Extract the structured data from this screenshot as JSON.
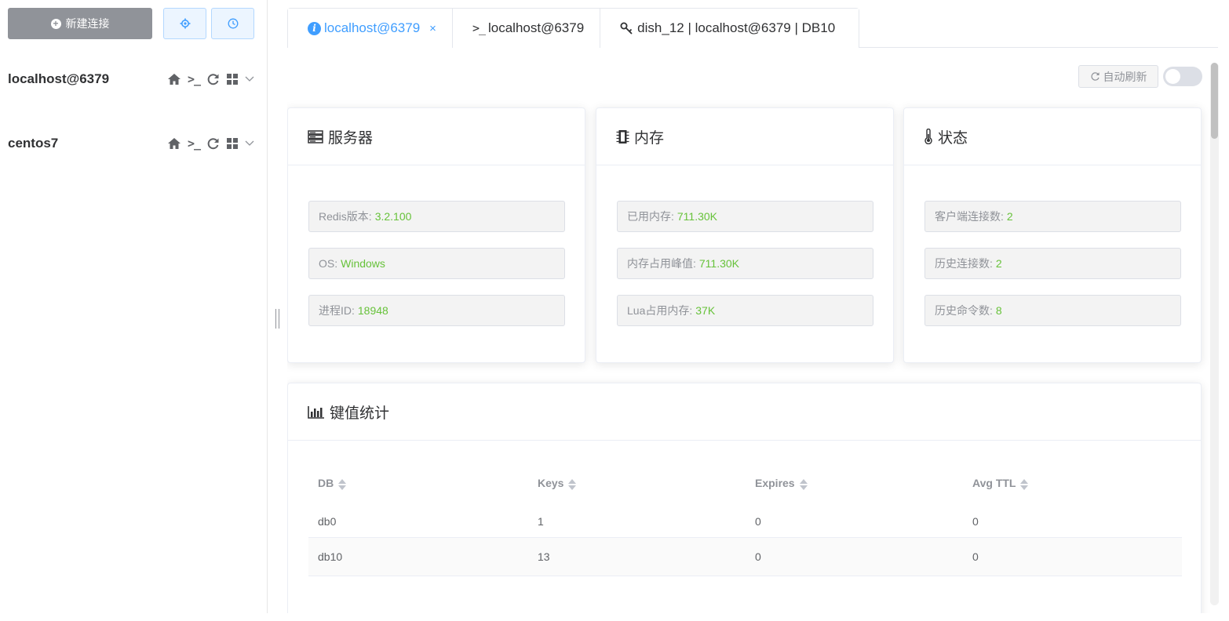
{
  "sidebar": {
    "new_connection_label": "新建连接",
    "connections": [
      {
        "name": "localhost@6379"
      },
      {
        "name": "centos7"
      }
    ],
    "terminal_glyph": ">_"
  },
  "tabs": [
    {
      "label": "localhost@6379",
      "icon": "info-icon",
      "active": true,
      "close": "×"
    },
    {
      "label": "localhost@6379",
      "icon": "terminal-icon",
      "glyph": ">_"
    },
    {
      "label": "dish_12 | localhost@6379 | DB10",
      "icon": "key-icon"
    }
  ],
  "toolbar": {
    "auto_refresh_label": "自动刷新",
    "auto_refresh_on": false
  },
  "server_card": {
    "title": "服务器",
    "rows": [
      {
        "label": "Redis版本:",
        "value": "3.2.100"
      },
      {
        "label": "OS:",
        "value": "Windows"
      },
      {
        "label": "进程ID:",
        "value": "18948"
      }
    ]
  },
  "memory_card": {
    "title": "内存",
    "rows": [
      {
        "label": "已用内存:",
        "value": "711.30K"
      },
      {
        "label": "内存占用峰值:",
        "value": "711.30K"
      },
      {
        "label": "Lua占用内存:",
        "value": "37K"
      }
    ]
  },
  "status_card": {
    "title": "状态",
    "rows": [
      {
        "label": "客户端连接数:",
        "value": "2"
      },
      {
        "label": "历史连接数:",
        "value": "2"
      },
      {
        "label": "历史命令数:",
        "value": "8"
      }
    ]
  },
  "keyspace_card": {
    "title": "键值统计",
    "columns": [
      "DB",
      "Keys",
      "Expires",
      "Avg TTL"
    ],
    "rows": [
      [
        "db0",
        "1",
        "0",
        "0"
      ],
      [
        "db10",
        "13",
        "0",
        "0"
      ]
    ]
  },
  "colors": {
    "accent": "#409eff",
    "value_green": "#67c23a",
    "muted": "#909399"
  }
}
